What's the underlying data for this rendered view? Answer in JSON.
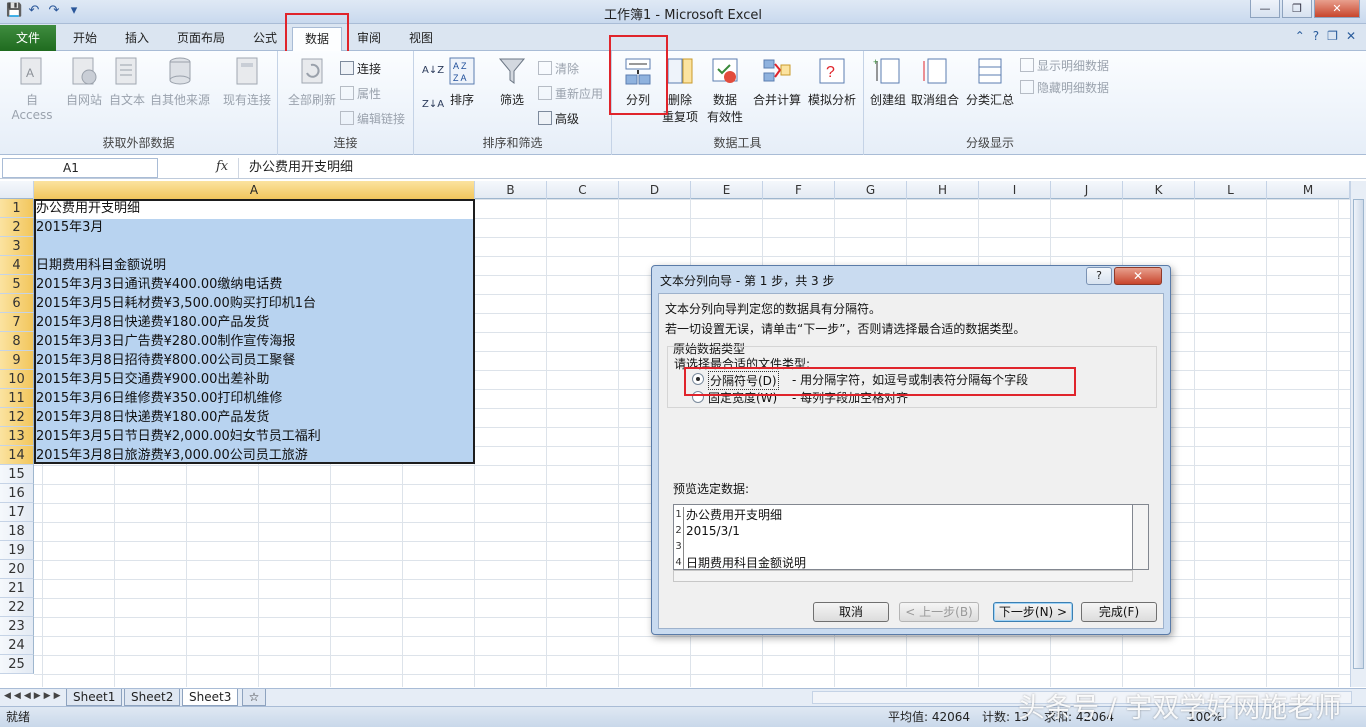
{
  "window": {
    "title": "工作簿1 - Microsoft Excel",
    "min": "—",
    "max": "❐",
    "close": "✕"
  },
  "qat": {
    "save": "💾",
    "undo": "↶",
    "redo": "↷",
    "customize": "▾"
  },
  "tabs": [
    {
      "label": "文件"
    },
    {
      "label": "开始"
    },
    {
      "label": "插入"
    },
    {
      "label": "页面布局"
    },
    {
      "label": "公式"
    },
    {
      "label": "数据"
    },
    {
      "label": "审阅"
    },
    {
      "label": "视图"
    }
  ],
  "active_tab": "数据",
  "ribbon": {
    "groups": {
      "external": "获取外部数据",
      "connections": "连接",
      "sort_filter": "排序和筛选",
      "data_tools": "数据工具",
      "outline": "分级显示"
    },
    "buttons": {
      "from_access": "自 Access",
      "from_web": "自网站",
      "from_text": "自文本",
      "from_other": "自其他来源",
      "existing": "现有连接",
      "refresh_all": "全部刷新",
      "connections": "连接",
      "properties": "属性",
      "edit_links": "编辑链接",
      "sort_az": "A↓Z",
      "sort_za": "Z↓A",
      "sort": "排序",
      "filter": "筛选",
      "clear": "清除",
      "reapply": "重新应用",
      "advanced": "高级",
      "text_to_columns": "分列",
      "remove_dup_1": "删除",
      "remove_dup_2": "重复项",
      "validation_1": "数据",
      "validation_2": "有效性",
      "consolidate": "合并计算",
      "whatif": "模拟分析",
      "group": "创建组",
      "ungroup": "取消组合",
      "subtotal": "分类汇总",
      "show_detail": "显示明细数据",
      "hide_detail": "隐藏明细数据"
    }
  },
  "formula_bar": {
    "name_box": "A1",
    "fx": "fx",
    "content": "办公费用开支明细"
  },
  "columns": [
    "A",
    "B",
    "C",
    "D",
    "E",
    "F",
    "G",
    "H",
    "I",
    "J",
    "K",
    "L",
    "M"
  ],
  "rows": [
    "1",
    "2",
    "3",
    "4",
    "5",
    "6",
    "7",
    "8",
    "9",
    "10",
    "11",
    "12",
    "13",
    "14",
    "15",
    "16",
    "17",
    "18",
    "19",
    "20",
    "21",
    "22",
    "23",
    "24",
    "25"
  ],
  "cells": [
    "办公费用开支明细",
    "2015年3月",
    "",
    "日期费用科目金额说明",
    "2015年3月3日通讯费¥400.00缴纳电话费",
    "2015年3月5日耗材费¥3,500.00购买打印机1台",
    "2015年3月8日快递费¥180.00产品发货",
    "2015年3月3日广告费¥280.00制作宣传海报",
    "2015年3月8日招待费¥800.00公司员工聚餐",
    "2015年3月5日交通费¥900.00出差补助",
    "2015年3月6日维修费¥350.00打印机维修",
    "2015年3月8日快递费¥180.00产品发货",
    "2015年3月5日节日费¥2,000.00妇女节员工福利",
    "2015年3月8日旅游费¥3,000.00公司员工旅游"
  ],
  "sheets": [
    {
      "label": "Sheet1"
    },
    {
      "label": "Sheet2"
    },
    {
      "label": "Sheet3"
    }
  ],
  "active_sheet": "Sheet3",
  "status": {
    "ready": "就绪",
    "average": "平均值: 42064",
    "count": "计数: 13",
    "sum": "求和: 42064",
    "zoom": "100%"
  },
  "dialog": {
    "title": "文本分列向导 - 第 1 步，共 3 步",
    "help": "?",
    "close": "✕",
    "intro_1": "文本分列向导判定您的数据具有分隔符。",
    "intro_2": "若一切设置无误，请单击“下一步”，否则请选择最合适的数据类型。",
    "group_title": "原始数据类型",
    "choose_label": "请选择最合适的文件类型:",
    "option_delimited": "分隔符号(D)",
    "option_delimited_desc": "- 用分隔字符，如逗号或制表符分隔每个字段",
    "option_fixed": "固定宽度(W)",
    "option_fixed_desc": "- 每列字段加空格对齐",
    "preview_label": "预览选定数据:",
    "preview_lines": [
      {
        "num": "1",
        "text": "办公费用开支明细"
      },
      {
        "num": "2",
        "text": "2015/3/1"
      },
      {
        "num": "3",
        "text": ""
      },
      {
        "num": "4",
        "text": "日期费用科目金额说明"
      }
    ],
    "buttons": {
      "cancel": "取消",
      "back": "< 上一步(B)",
      "next": "下一步(N) >",
      "finish": "完成(F)"
    }
  },
  "watermark": "头条号 / 宇双学好网施老师"
}
